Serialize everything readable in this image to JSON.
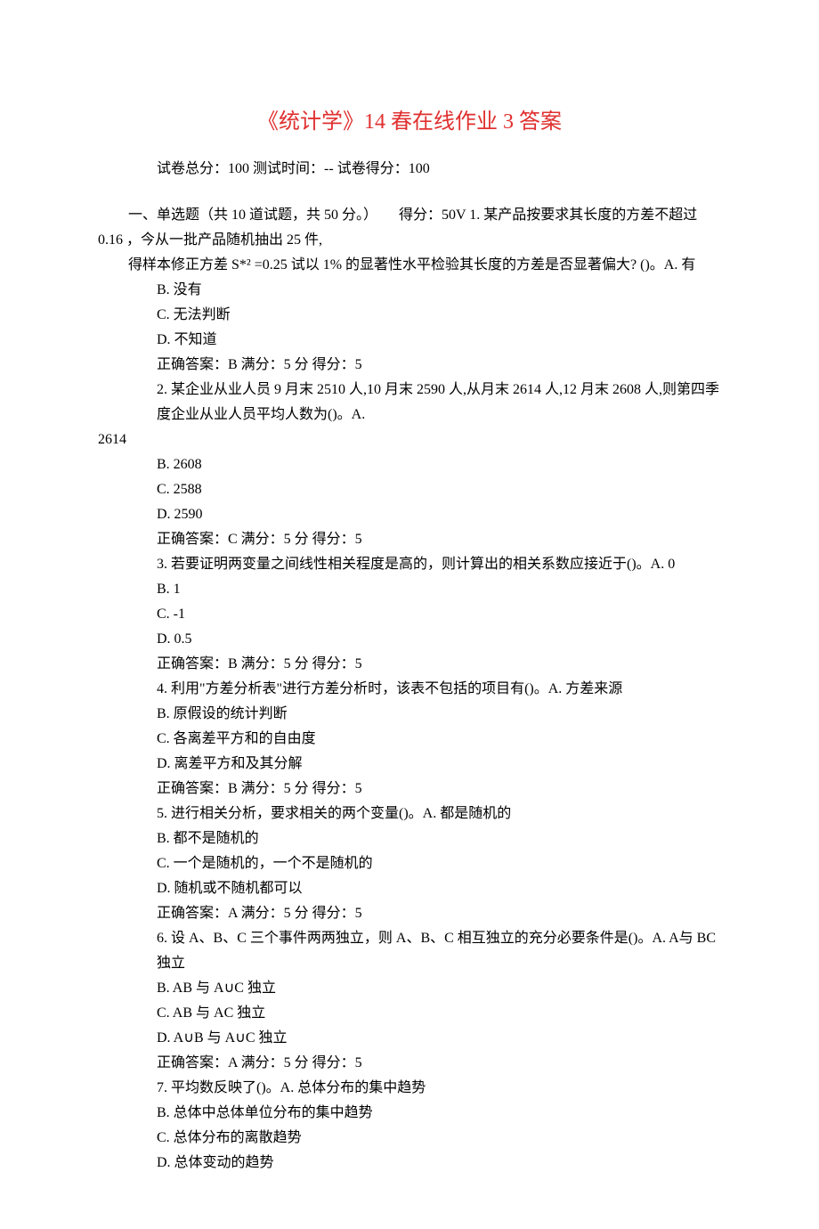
{
  "title": "《统计学》14 春在线作业 3 答案",
  "meta": {
    "total_label": "试卷总分：",
    "total_value": "100",
    "time_label": "测试时间：",
    "time_value": "--",
    "score_label": "试卷得分：",
    "score_value": "100"
  },
  "section_intro_a": "一、单选题（共 10 道试题，共 50 分。）",
  "section_intro_b": "得分：50V 1.   某产品按要求其长度的方差不超过 0.16 ，今从一批产品随机抽出 25 件,",
  "q1_line2": "得样本修正方差 S*² =0.25  试以  1%  的显著性水平检验其长度的方差是否显著偏大? ()。A. 有",
  "q1_B": "B.  没有",
  "q1_C": "C.  无法判断",
  "q1_D": "D.  不知道",
  "q1_ans": "正确答案：B          满分：5   分   得分：5",
  "q2_line1": "2.   某企业从业人员 9 月末 2510 人,10 月末 2590 人,从月末 2614 人,12 月末 2608 人,则第四季度企业从业人员平均人数为()。A.",
  "q2_line2": "2614",
  "q2_B": "B. 2608",
  "q2_C": "C. 2588",
  "q2_D": "D. 2590",
  "q2_ans": "正确答案：C          满分：5   分   得分：5",
  "q3_line1": "3.   若要证明两变量之间线性相关程度是高的，则计算出的相关系数应接近于()。A. 0",
  "q3_B": "B. 1",
  "q3_C": "C. -1",
  "q3_D": "D. 0.5",
  "q3_ans": "正确答案：B          满分：5   分   得分：5",
  "q4_line1": "4.   利用\"方差分析表\"进行方差分析时，该表不包括的项目有()。A. 方差来源",
  "q4_B": "B. 原假设的统计判断",
  "q4_C": "C. 各离差平方和的自由度",
  "q4_D": "D. 离差平方和及其分解",
  "q4_ans": "正确答案：B          满分：5   分   得分：5",
  "q5_line1": "5.   进行相关分析，要求相关的两个变量()。A. 都是随机的",
  "q5_B": "B. 都不是随机的",
  "q5_C": "C. 一个是随机的，一个不是随机的",
  "q5_D": "D. 随机或不随机都可以",
  "q5_ans": "正确答案：A          满分：5   分   得分：5",
  "q6_line1": "6.   设 A、B、C 三个事件两两独立，则 A、B、C 相互独立的充分必要条件是()。A. A与 BC 独立",
  "q6_B": "B. AB 与 A∪C 独立",
  "q6_C": "C. AB 与 AC 独立",
  "q6_D": "D. A∪B 与 A∪C 独立",
  "q6_ans": "正确答案：A          满分：5   分   得分：5",
  "q7_line1": "7.   平均数反映了()。A. 总体分布的集中趋势",
  "q7_B": "B. 总体中总体单位分布的集中趋势",
  "q7_C": "C. 总体分布的离散趋势",
  "q7_D": "D. 总体变动的趋势"
}
